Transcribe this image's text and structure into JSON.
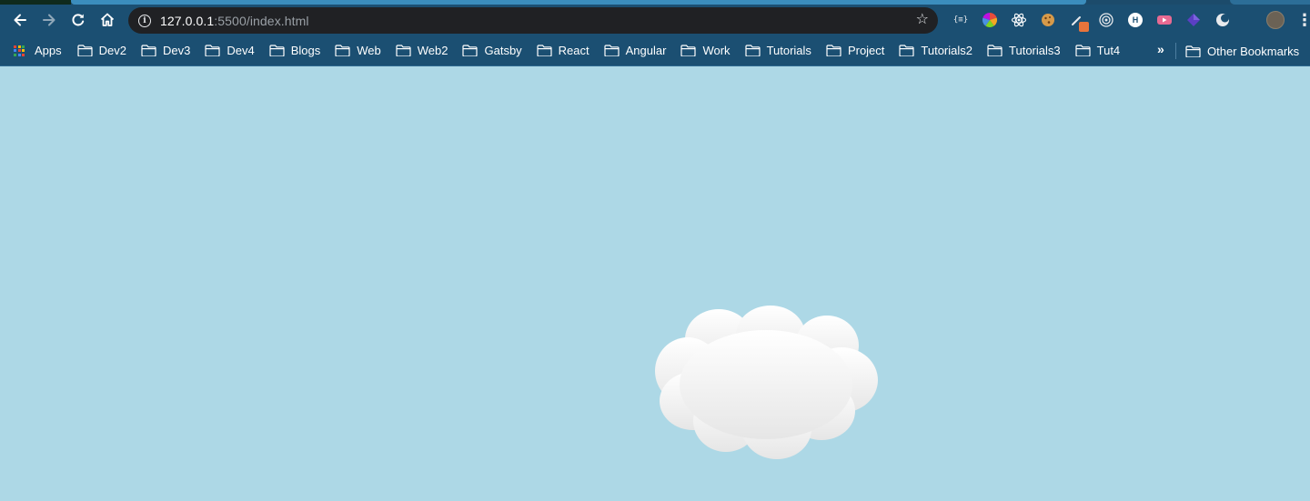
{
  "browser": {
    "url_host": "127.0.0.1",
    "url_rest": ":5500/index.html",
    "icons": {
      "back": "arrow-left-icon",
      "forward": "arrow-right-icon",
      "reload": "reload-icon",
      "home": "home-icon",
      "site_info": "info-icon",
      "bookmark_star": "star-icon",
      "menu": "kebab-menu-icon"
    },
    "extensions": [
      {
        "name": "json-viewer-extension-icon",
        "text": "{≡}"
      },
      {
        "name": "color-wheel-extension-icon"
      },
      {
        "name": "react-devtools-extension-icon"
      },
      {
        "name": "cookie-extension-icon"
      },
      {
        "name": "eyedropper-extension-icon"
      },
      {
        "name": "target-extension-icon"
      },
      {
        "name": "hosting-extension-icon",
        "text": "H"
      },
      {
        "name": "video-extension-icon"
      },
      {
        "name": "layers-extension-icon"
      },
      {
        "name": "moon-extension-icon"
      }
    ],
    "colors": {
      "toolbar": "#1b4f72",
      "omnibox": "#202124",
      "page_background": "#add8e6"
    }
  },
  "bookmarks": {
    "apps_label": "Apps",
    "folders": [
      "Dev2",
      "Dev3",
      "Dev4",
      "Blogs",
      "Web",
      "Web2",
      "Gatsby",
      "React",
      "Angular",
      "Work",
      "Tutorials",
      "Project",
      "Tutorials2",
      "Tutorials3",
      "Tut4"
    ],
    "overflow": "»",
    "other_label": "Other Bookmarks"
  },
  "page": {
    "background": "#add8e6",
    "shape": "cloud",
    "cloud_gradient": [
      "#ffffff",
      "#e6e6e6"
    ]
  }
}
